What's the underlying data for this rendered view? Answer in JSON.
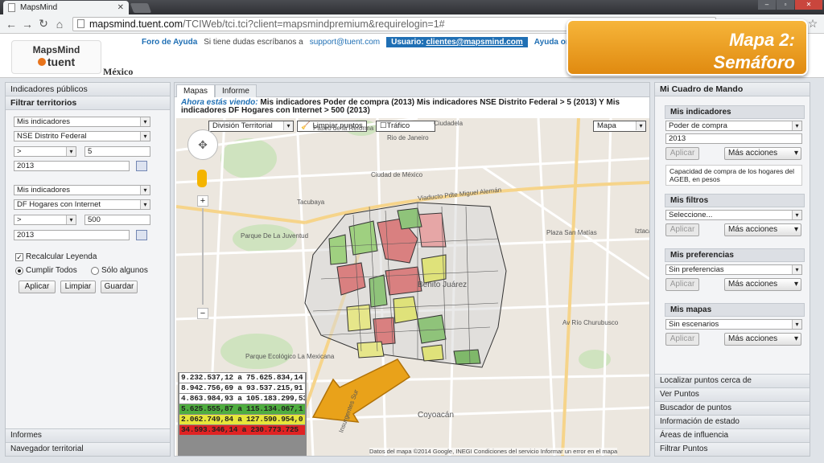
{
  "browser": {
    "tab_title": "MapsMind",
    "url_host": "mapsmind.tuent.com",
    "url_path": "/TCIWeb/tci.tci?client=mapsmindpremium&requirelogin=1#"
  },
  "header": {
    "logo_top": "MapsMind",
    "logo_bottom": "tuent",
    "country": "México",
    "help_link": "Foro de Ayuda",
    "help_text": "Si tiene dudas escríbanos a",
    "support_email": "support@tuent.com",
    "user_label": "Usuario:",
    "user_email": "clientes@mapsmind.com",
    "online_help": "Ayuda onlin"
  },
  "overlay": {
    "line1": "Mapa 2:",
    "line2": "Semáforo"
  },
  "left": {
    "section1": "Indicadores públicos",
    "section2": "Filtrar territorios",
    "f1_source": "Mis indicadores",
    "f1_indicator": "NSE Distrito Federal",
    "f1_op": ">",
    "f1_value": "5",
    "f1_year": "2013",
    "f2_source": "Mis indicadores",
    "f2_indicator": "DF Hogares con Internet",
    "f2_op": ">",
    "f2_value": "500",
    "f2_year": "2013",
    "recalc": "Recalcular Leyenda",
    "opt_all": "Cumplir Todos",
    "opt_some": "Sólo algunos",
    "btn_apply": "Aplicar",
    "btn_clear": "Limpiar",
    "btn_save": "Guardar",
    "bottom1": "Informes",
    "bottom2": "Navegador territorial"
  },
  "center": {
    "tab_maps": "Mapas",
    "tab_report": "Informe",
    "viewing_label": "Ahora estás viendo:",
    "viewing_text": "Mis indicadores Poder de compra (2013) Mis indicadores NSE Distrito Federal > 5 (2013) Y Mis indicadores DF Hogares con Internet > 500 (2013)",
    "division": "División Territorial",
    "clear_points": "Limpiar puntos",
    "traffic": "Tráfico",
    "map_type": "Mapa",
    "attribution": "Datos del mapa ©2014 Google, INEGI   Condiciones del servicio   Informar un error en el mapa",
    "labels": [
      "Ciudadela",
      "Paseo de la Reforma",
      "Rio de Janeiro",
      "Ciudad de México",
      "Viaducto Pdte Miguel Alemán",
      "Tacubaya",
      "Parque De La Juventud",
      "Benito Juárez",
      "Plaza San Matías",
      "Coyoacán",
      "Parque Ecológico La Mexicana",
      "Iztacalco",
      "Av Río Churubusco",
      "Insurgentes Sur"
    ],
    "legend": [
      {
        "text": "9.232.537,12 a 75.625.834,14",
        "color": "#ffffff"
      },
      {
        "text": "8.942.756,69 a 93.537.215,91",
        "color": "#ffffff"
      },
      {
        "text": "4.863.984,93 a 105.183.299,53",
        "color": "#ffffff"
      },
      {
        "text": "5.625.555,87 a 115.134.067,1",
        "color": "#4fae3f"
      },
      {
        "text": "2.062.749,84 a 127.590.954,0",
        "color": "#e6e63a"
      },
      {
        "text": "34.593.346,14 a 230.773.725",
        "color": "#e02323"
      }
    ]
  },
  "right": {
    "title": "Mi Cuadro de Mando",
    "ind_head": "Mis indicadores",
    "ind_select": "Poder de compra",
    "ind_year": "2013",
    "ind_apply": "Aplicar",
    "ind_more": "Más acciones",
    "ind_desc": "Capacidad de compra de los hogares del AGEB, en pesos",
    "fil_head": "Mis filtros",
    "fil_select": "Seleccione...",
    "fil_apply": "Aplicar",
    "fil_more": "Más acciones",
    "pref_head": "Mis preferencias",
    "pref_select": "Sin preferencias",
    "pref_apply": "Aplicar",
    "pref_more": "Más acciones",
    "maps_head": "Mis mapas",
    "maps_select": "Sin escenarios",
    "maps_apply": "Aplicar",
    "maps_more": "Más acciones",
    "list": [
      "Localizar puntos cerca de",
      "Ver Puntos",
      "Buscador de puntos",
      "Información de estado",
      "Áreas de influencia",
      "Filtrar Puntos"
    ]
  }
}
